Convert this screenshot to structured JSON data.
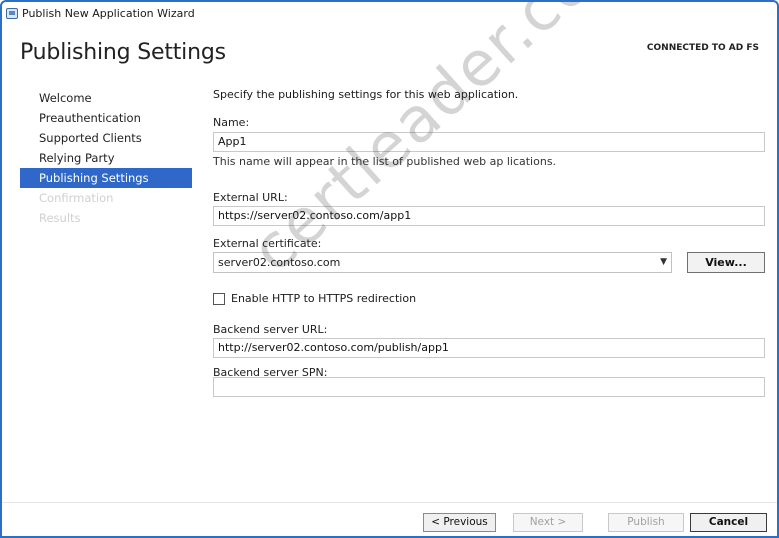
{
  "window": {
    "title": "Publish New Application Wizard",
    "app_icon": "wizard-window-icon"
  },
  "header": {
    "page_title": "Publishing Settings",
    "connection_status": "CONNECTED TO AD FS"
  },
  "nav": {
    "items": [
      {
        "label": "Welcome",
        "state": "normal"
      },
      {
        "label": "Preauthentication",
        "state": "normal"
      },
      {
        "label": "Supported Clients",
        "state": "normal"
      },
      {
        "label": "Relying Party",
        "state": "normal"
      },
      {
        "label": "Publishing Settings",
        "state": "active"
      },
      {
        "label": "Confirmation",
        "state": "disabled"
      },
      {
        "label": "Results",
        "state": "disabled"
      }
    ]
  },
  "main": {
    "intro": "Specify the publishing settings for this web application.",
    "name": {
      "label": "Name:",
      "value": "App1",
      "note": "This name will appear in the list of published web ap lications."
    },
    "external_url": {
      "label": "External URL:",
      "value": "https://server02.contoso.com/app1"
    },
    "external_certificate": {
      "label": "External certificate:",
      "value": "server02.contoso.com",
      "view_button": "View..."
    },
    "http_redirect": {
      "label": "Enable HTTP to HTTPS redirection",
      "checked": false
    },
    "backend_url": {
      "label": "Backend server URL:",
      "value": "http://server02.contoso.com/publish/app1"
    },
    "backend_spn": {
      "label": "Backend server SPN:",
      "value": ""
    }
  },
  "footer": {
    "previous": "< Previous",
    "next": "Next >",
    "publish": "Publish",
    "cancel": "Cancel"
  },
  "watermark": "certleader.com",
  "colors": {
    "accent": "#2f68c8",
    "frame": "#2c6fc7"
  }
}
